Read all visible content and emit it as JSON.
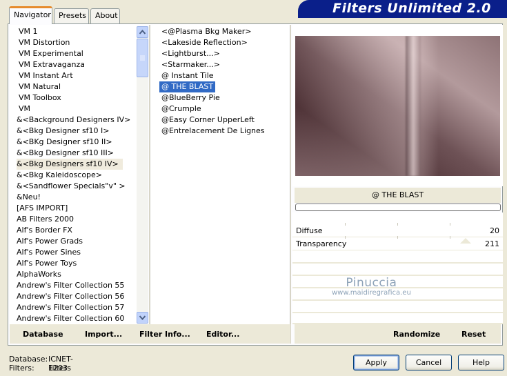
{
  "app": {
    "title": "Filters Unlimited 2.0"
  },
  "tabs": [
    {
      "label": "Navigator",
      "active": true
    },
    {
      "label": "Presets",
      "active": false
    },
    {
      "label": "About",
      "active": false
    }
  ],
  "categories": {
    "selected": "&<Bkg Designers sf10 IV>",
    "items": [
      "VM 1",
      "VM Distortion",
      "VM Experimental",
      "VM Extravaganza",
      "VM Instant Art",
      "VM Natural",
      "VM Toolbox",
      "VM",
      "&<Background Designers IV>",
      "&<Bkg Designer sf10 I>",
      "&<BKg Designer sf10 II>",
      "&<Bkg Designer sf10 III>",
      "&<Bkg Designers sf10 IV>",
      "&<Bkg Kaleidoscope>",
      "&<Sandflower Specials\"v\" >",
      "&Neu!",
      "[AFS IMPORT]",
      "AB Filters 2000",
      "Alf's Border FX",
      "Alf's Power Grads",
      "Alf's Power Sines",
      "Alf's Power Toys",
      "AlphaWorks",
      "Andrew's Filter Collection 55",
      "Andrew's Filter Collection 56",
      "Andrew's Filter Collection 57",
      "Andrew's Filter Collection 60"
    ]
  },
  "filters": {
    "selected": "@ THE BLAST",
    "items": [
      "<@Plasma Bkg Maker>",
      "<Lakeside Reflection>",
      "<Lightburst...>",
      "<Starmaker...>",
      "@ Instant Tile",
      "@ THE BLAST",
      "@BlueBerry Pie",
      "@Crumple",
      "@Easy Corner UpperLeft",
      "@Entrelacement De Lignes"
    ]
  },
  "preview": {
    "filter_name": "@ THE BLAST"
  },
  "params": [
    {
      "label": "Diffuse",
      "value": "20"
    },
    {
      "label": "Transparency",
      "value": "211"
    }
  ],
  "watermark": {
    "line1": "Pinuccia",
    "line2": "www.maidiregrafica.eu"
  },
  "panel_buttons": {
    "database": "Database",
    "import": "Import...",
    "filter_info": "Filter Info...",
    "editor": "Editor...",
    "randomize": "Randomize",
    "reset": "Reset"
  },
  "info": {
    "database_label": "Database:",
    "database_value": "ICNET-Filters",
    "filters_label": "Filters:",
    "filters_value": "1203"
  },
  "buttons": {
    "apply": "Apply",
    "cancel": "Cancel",
    "help": "Help"
  },
  "colors": {
    "banner": "#0a1f8a",
    "selection": "#316ac5",
    "tab_accent": "#e68b2c"
  }
}
